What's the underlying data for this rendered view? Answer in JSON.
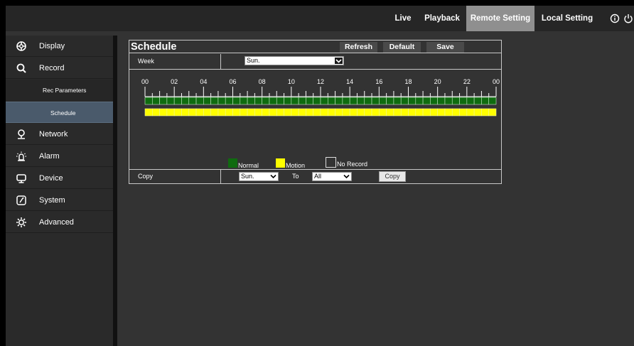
{
  "topnav": {
    "items": [
      {
        "label": "Live",
        "active": false
      },
      {
        "label": "Playback",
        "active": false
      },
      {
        "label": "Remote Setting",
        "active": true
      },
      {
        "label": "Local Setting",
        "active": false
      }
    ],
    "icons": [
      "info-icon",
      "power-icon"
    ]
  },
  "sidebar": {
    "items": [
      {
        "label": "Display",
        "icon": "display-icon"
      },
      {
        "label": "Record",
        "icon": "search-icon"
      },
      {
        "label": "Network",
        "icon": "network-icon"
      },
      {
        "label": "Alarm",
        "icon": "alarm-icon"
      },
      {
        "label": "Device",
        "icon": "device-icon"
      },
      {
        "label": "System",
        "icon": "system-icon"
      },
      {
        "label": "Advanced",
        "icon": "advanced-icon"
      }
    ],
    "subitems": [
      {
        "label": "Rec Parameters",
        "active": false
      },
      {
        "label": "Schedule",
        "active": true
      }
    ]
  },
  "schedule": {
    "title": "Schedule",
    "buttons": {
      "refresh": "Refresh",
      "default": "Default",
      "save": "Save"
    },
    "week_label": "Week",
    "week_value": "Sun.",
    "hour_ticks": [
      "00",
      "02",
      "04",
      "06",
      "08",
      "10",
      "12",
      "14",
      "16",
      "18",
      "20",
      "22",
      "00"
    ],
    "legend": [
      {
        "label": "Normal",
        "color": "#0f6b0f"
      },
      {
        "label": "Motion",
        "color": "#ffff00"
      },
      {
        "label": "No Record",
        "color": "#333333"
      }
    ],
    "copy_label": "Copy",
    "copy_from": "Sun.",
    "to_label": "To",
    "copy_to": "All",
    "copy_button": "Copy"
  },
  "colors": {
    "normal": "#0f6b0f",
    "motion": "#ffff00",
    "accent_active": "#4a5a6b"
  }
}
